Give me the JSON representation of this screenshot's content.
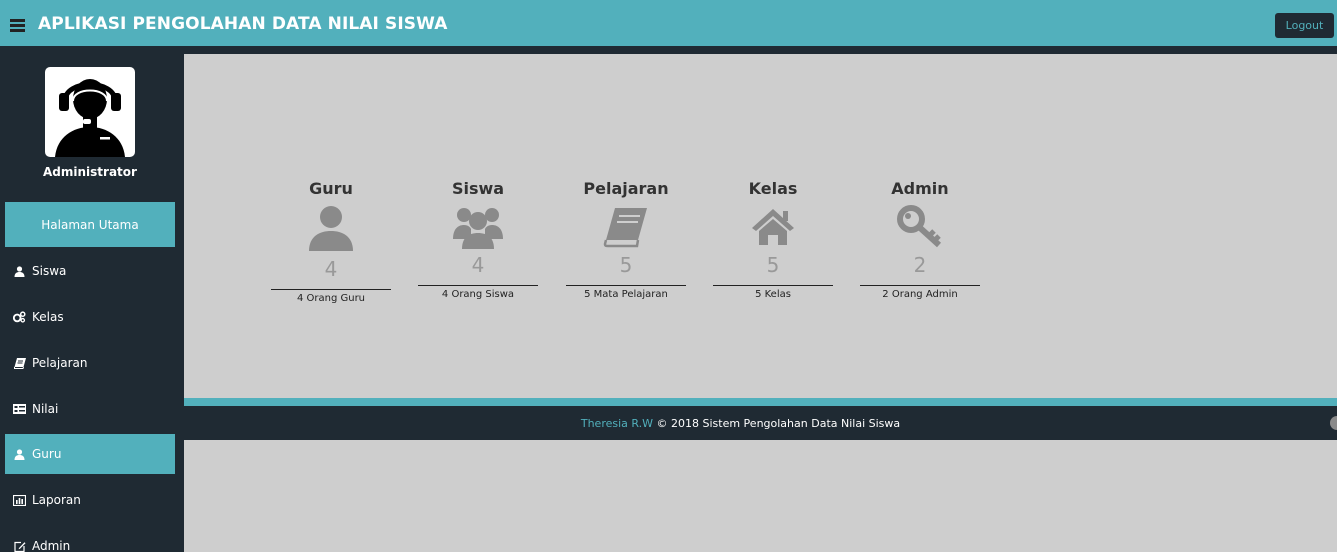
{
  "header": {
    "title": "APLIKASI PENGOLAHAN DATA NILAI SISWA",
    "logout_label": "Logout",
    "menu_icon": "hamburger-icon"
  },
  "sidebar": {
    "user_name": "Administrator",
    "avatar_icon": "headset-operator-icon",
    "items": [
      {
        "label": "Halaman Utama",
        "icon": "",
        "active": true
      },
      {
        "label": "Siswa",
        "icon": "user-icon"
      },
      {
        "label": "Kelas",
        "icon": "cogs-icon"
      },
      {
        "label": "Pelajaran",
        "icon": "book-icon"
      },
      {
        "label": "Nilai",
        "icon": "list-card-icon"
      },
      {
        "label": "Guru",
        "icon": "user-icon",
        "active": true
      },
      {
        "label": "Laporan",
        "icon": "bar-chart-icon"
      },
      {
        "label": "Admin",
        "icon": "edit-icon"
      }
    ]
  },
  "stats": [
    {
      "title": "Guru",
      "count": "4",
      "caption": "4 Orang Guru",
      "icon": "user-icon"
    },
    {
      "title": "Siswa",
      "count": "4",
      "caption": "4 Orang Siswa",
      "icon": "users-group-icon"
    },
    {
      "title": "Pelajaran",
      "count": "5",
      "caption": "5 Mata Pelajaran",
      "icon": "book-icon"
    },
    {
      "title": "Kelas",
      "count": "5",
      "caption": "5 Kelas",
      "icon": "home-icon"
    },
    {
      "title": "Admin",
      "count": "2",
      "caption": "2 Orang Admin",
      "icon": "key-icon"
    }
  ],
  "footer": {
    "author": "Theresia R.W",
    "text": " © 2018 Sistem Pengolahan Data Nilai Siswa"
  },
  "colors": {
    "accent": "#52b0bc",
    "dark": "#1f2a33",
    "content_bg": "#cecece",
    "icon_gray": "#8a8a8a"
  }
}
